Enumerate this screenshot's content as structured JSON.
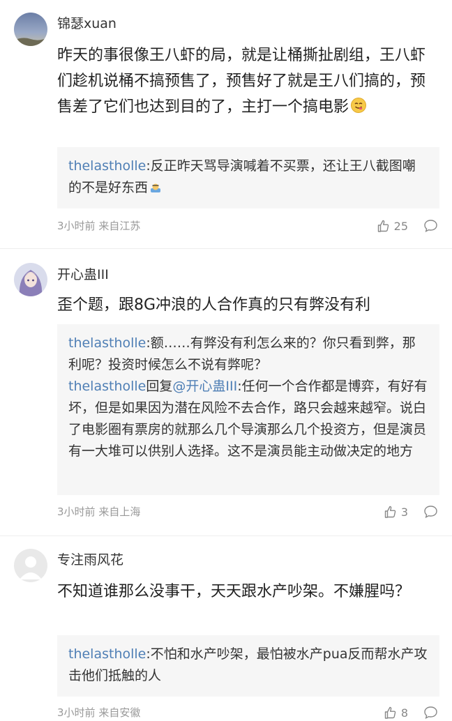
{
  "comments": [
    {
      "username": "锦瑟xuan",
      "text": "昨天的事很像王八虾的局，就是让桶撕扯剧组，王八虾们趁机说桶不搞预售了，预售好了就是王八们搞的，预售差了它们也达到目的了，主打一个搞电影",
      "emoji": "yummy-face-emoji",
      "replies": [
        {
          "user": "thelastholle",
          "sep": ":",
          "text": "反正昨天骂导演喊着不买票，还让王八截图嘲的不是好东西",
          "emoji": "bowing-emoji"
        }
      ],
      "time": "3小时前",
      "location": "来自江苏",
      "likes": "25"
    },
    {
      "username": "开心蛊III",
      "text": "歪个题，跟8G冲浪的人合作真的只有弊没有利",
      "replies": [
        {
          "user": "thelastholle",
          "sep": ":",
          "text": "额……有弊没有利怎么来的？你只看到弊，那利呢？投资时候怎么不说有弊呢？"
        },
        {
          "user": "thelastholle",
          "reply_word": "回复",
          "mention": "@开心蛊III",
          "sep": ":",
          "text": "任何一个合作都是博弈，有好有坏，但是如果因为潜在风险不去合作，路只会越来越窄。说白了电影圈有票房的就那么几个导演那么几个投资方，但是演员有一大堆可以供别人选择。这不是演员能主动做决定的地方"
        }
      ],
      "time": "3小时前",
      "location": "来自上海",
      "likes": "3"
    },
    {
      "username": "专注雨风花",
      "text": "不知道谁那么没事干，天天跟水产吵架。不嫌腥吗？",
      "replies": [
        {
          "user": "thelastholle",
          "sep": ":",
          "text": "不怕和水产吵架，最怕被水产pua反而帮水产攻击他们抵触的人"
        }
      ],
      "time": "3小时前",
      "location": "来自安徽",
      "likes": "8"
    }
  ],
  "icons": {
    "like": "thumbs-up-icon",
    "comment": "comment-bubble-icon"
  },
  "colors": {
    "link": "#4f7fb5",
    "reply_bg": "#f6f6f6",
    "meta": "#999999"
  }
}
